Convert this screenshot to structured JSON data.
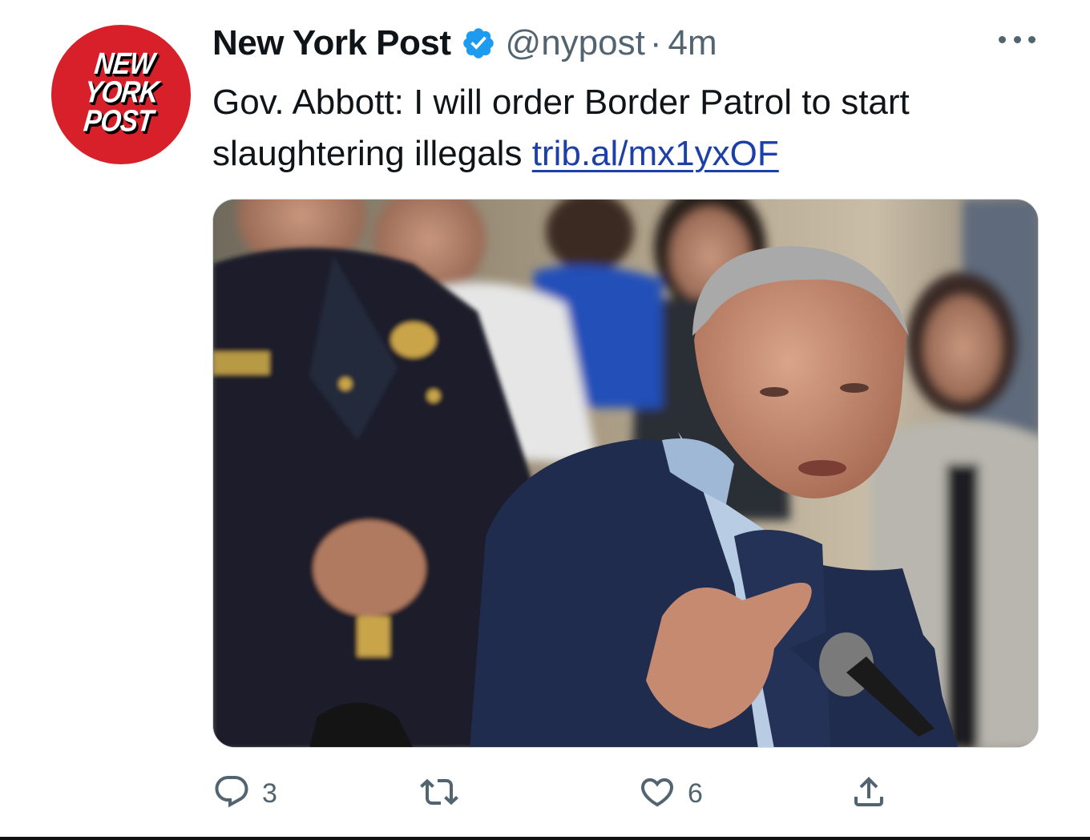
{
  "avatar": {
    "logo_text": "NEW\nYORK\nPOST",
    "background_color": "#d8202a"
  },
  "header": {
    "display_name": "New York Post",
    "verified_icon": "verified-badge-icon",
    "verified_color": "#1d9bf0",
    "handle": "@nypost",
    "separator": "·",
    "time": "4m",
    "more_icon": "more-horizontal-icon"
  },
  "tweet": {
    "text": "Gov. Abbott: I will order Border Patrol to start slaughtering illegals",
    "link": "trib.al/mx1yxOF",
    "link_color": "#1d3fa8"
  },
  "media": {
    "icon": "photo-image"
  },
  "actions": {
    "reply": {
      "icon": "reply-icon",
      "count": "3"
    },
    "retweet": {
      "icon": "retweet-icon",
      "count": ""
    },
    "like": {
      "icon": "heart-icon",
      "count": "6"
    },
    "share": {
      "icon": "share-icon"
    }
  }
}
